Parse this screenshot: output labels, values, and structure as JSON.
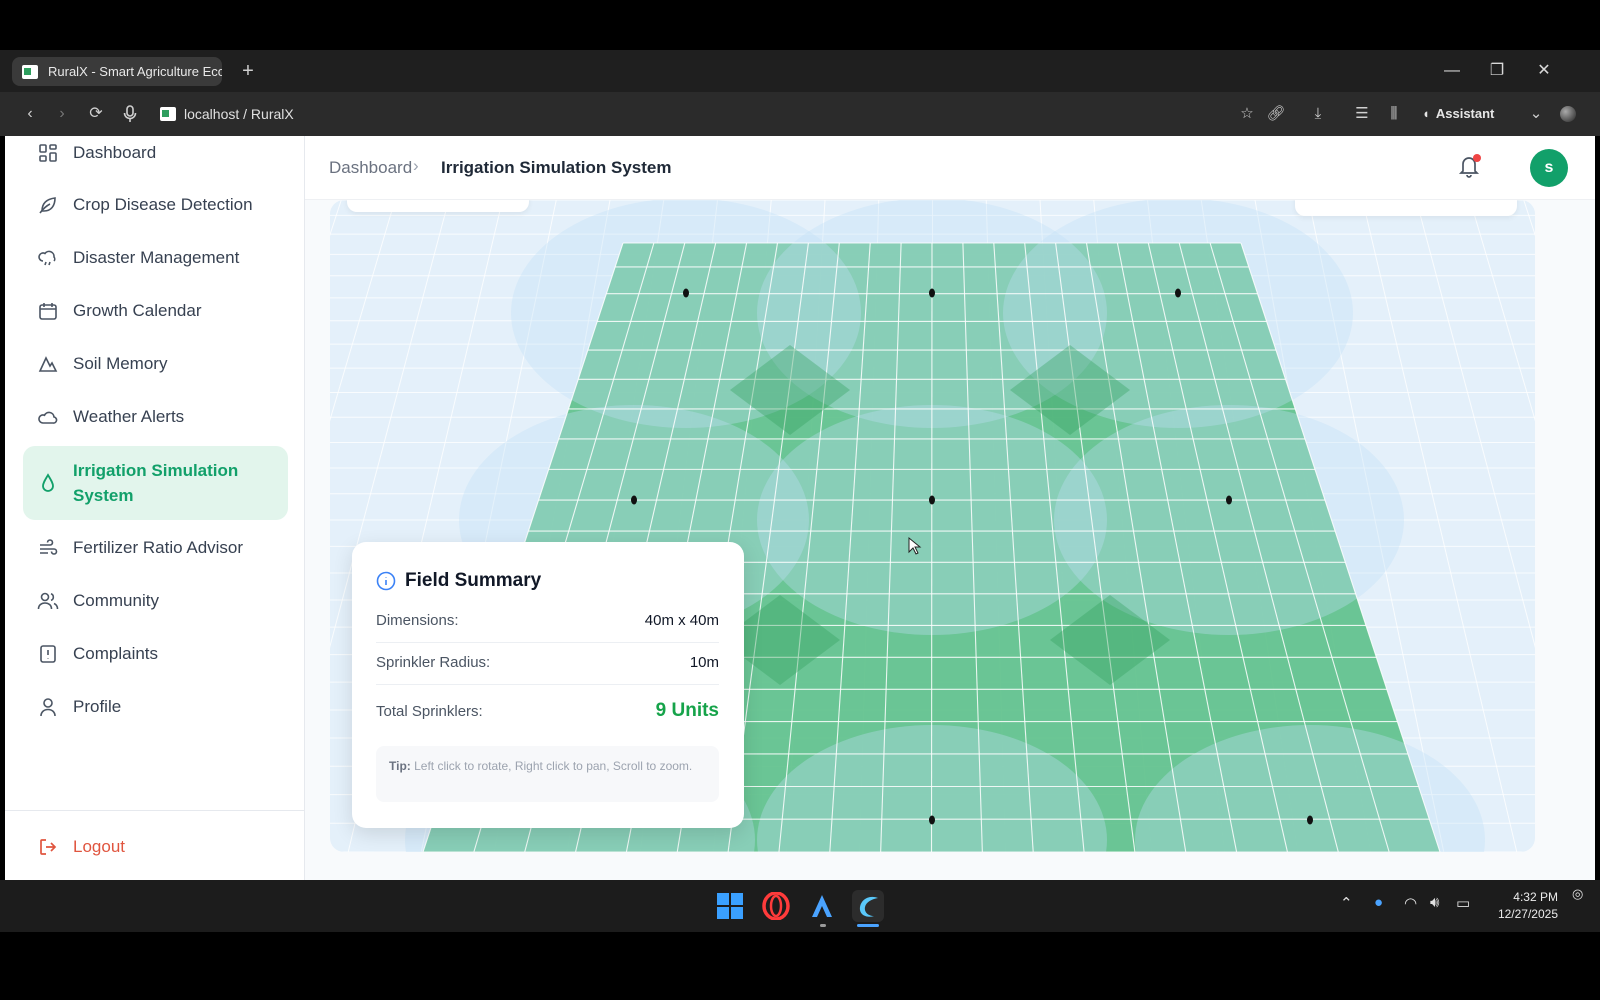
{
  "browser": {
    "tab_title": "RuralX - Smart Agriculture Ecosystem",
    "url": "localhost / RuralX",
    "assistant_label": "Assistant"
  },
  "sidebar": {
    "items": [
      {
        "label": "Dashboard",
        "icon": "dashboard-grid-icon"
      },
      {
        "label": "Crop Disease Detection",
        "icon": "leaf-icon"
      },
      {
        "label": "Disaster Management",
        "icon": "storm-cloud-icon"
      },
      {
        "label": "Growth Calendar",
        "icon": "calendar-icon"
      },
      {
        "label": "Soil Memory",
        "icon": "mountain-icon"
      },
      {
        "label": "Weather Alerts",
        "icon": "cloud-icon"
      },
      {
        "label": "Irrigation Simulation",
        "label2": "System",
        "icon": "droplet-icon",
        "active": true
      },
      {
        "label": "Fertilizer Ratio Advisor",
        "icon": "wind-icon"
      },
      {
        "label": "Community",
        "icon": "users-icon"
      },
      {
        "label": "Complaints",
        "icon": "alert-file-icon"
      },
      {
        "label": "Profile",
        "icon": "user-icon"
      }
    ],
    "logout_label": "Logout"
  },
  "header": {
    "breadcrumb_root": "Dashboard",
    "breadcrumb_current": "Irrigation Simulation System",
    "avatar_initial": "s"
  },
  "summary": {
    "title": "Field Summary",
    "dimensions_label": "Dimensions:",
    "dimensions_value": "40m x 40m",
    "radius_label": "Sprinkler Radius:",
    "radius_value": "10m",
    "total_label": "Total Sprinklers:",
    "total_value": "9 Units",
    "tip_label": "Tip:",
    "tip_text": "Left click to rotate, Right click to pan, Scroll to zoom."
  },
  "taskbar": {
    "time": "4:32 PM",
    "date": "12/27/2025"
  },
  "colors": {
    "accent": "#12a06a",
    "field": "#5cc08a",
    "logout": "#e0553f"
  }
}
